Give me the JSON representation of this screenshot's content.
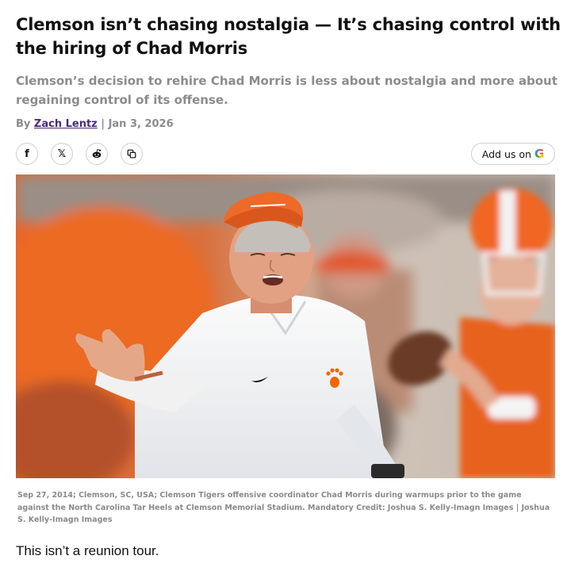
{
  "article": {
    "headline": "Clemson isn’t chasing nostalgia — It’s chasing control with the hiring of Chad Morris",
    "dek": "Clemson’s decision to rehire Chad Morris is less about nostalgia and more about regaining control of its offense.",
    "byline": {
      "prefix": "By",
      "author": "Zach Lentz",
      "separator": "|",
      "date": "Jan 3, 2026"
    },
    "share": {
      "buttons": [
        {
          "icon": "facebook-icon",
          "glyph": "f"
        },
        {
          "icon": "x-icon",
          "glyph": "𝕏"
        },
        {
          "icon": "reddit-icon",
          "glyph": ""
        },
        {
          "icon": "copy-link-icon",
          "glyph": ""
        }
      ],
      "add_us_label": "Add us on",
      "google_glyph": "G"
    },
    "photo": {
      "caption": "Sep 27, 2014; Clemson, SC, USA; Clemson Tigers offensive coordinator Chad Morris during warmups prior to the game against the North Carolina Tar Heels at Clemson Memorial Stadium. Mandatory Credit: Joshua S. Kelly-Imagn Images | Joshua S. Kelly-Imagn Images"
    },
    "lead_paragraph": "This isn’t a reunion tour."
  },
  "colors": {
    "author_link": "#4b2a7b",
    "muted_text": "#8c8c8c",
    "clemson_orange": "#f56600"
  }
}
